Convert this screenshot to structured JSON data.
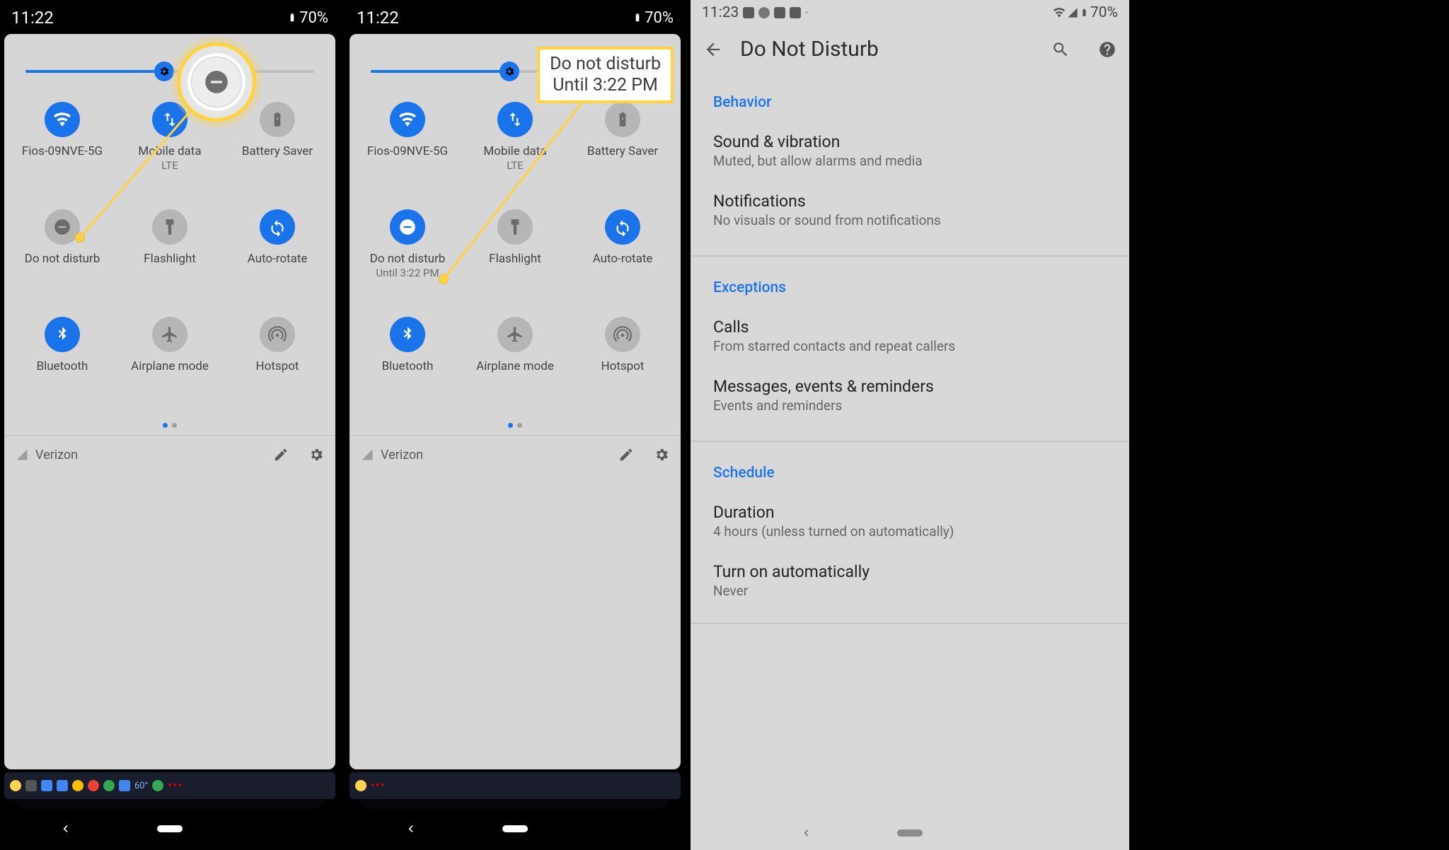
{
  "screens": {
    "a": {
      "time": "11:22",
      "battery": "70%",
      "brightness_pct": 48,
      "carrier": "Verizon",
      "tiles": [
        {
          "name": "wifi",
          "label": "Fios-09NVE-5G",
          "sub": null,
          "on": true,
          "icon": "wifi"
        },
        {
          "name": "mobile-data",
          "label": "Mobile data",
          "sub": "LTE",
          "on": true,
          "icon": "swap"
        },
        {
          "name": "battery-saver",
          "label": "Battery Saver",
          "sub": null,
          "on": false,
          "icon": "battery"
        },
        {
          "name": "dnd",
          "label": "Do not disturb",
          "sub": null,
          "on": false,
          "icon": "dnd"
        },
        {
          "name": "flashlight",
          "label": "Flashlight",
          "sub": null,
          "on": false,
          "icon": "flash"
        },
        {
          "name": "auto-rotate",
          "label": "Auto-rotate",
          "sub": null,
          "on": true,
          "icon": "rotate"
        },
        {
          "name": "bluetooth",
          "label": "Bluetooth",
          "sub": null,
          "on": true,
          "icon": "bt"
        },
        {
          "name": "airplane",
          "label": "Airplane mode",
          "sub": null,
          "on": false,
          "icon": "airplane"
        },
        {
          "name": "hotspot",
          "label": "Hotspot",
          "sub": null,
          "on": false,
          "icon": "hotspot"
        }
      ],
      "strip_temp": "60°"
    },
    "b": {
      "time": "11:22",
      "battery": "70%",
      "brightness_pct": 48,
      "carrier": "Verizon",
      "callout_line1": "Do not disturb",
      "callout_line2": "Until 3:22 PM",
      "tiles": [
        {
          "name": "wifi",
          "label": "Fios-09NVE-5G",
          "sub": null,
          "on": true,
          "icon": "wifi"
        },
        {
          "name": "mobile-data",
          "label": "Mobile data",
          "sub": "LTE",
          "on": true,
          "icon": "swap"
        },
        {
          "name": "battery-saver",
          "label": "Battery Saver",
          "sub": null,
          "on": false,
          "icon": "battery"
        },
        {
          "name": "dnd",
          "label": "Do not disturb",
          "sub": "Until 3:22 PM",
          "on": true,
          "icon": "dnd"
        },
        {
          "name": "flashlight",
          "label": "Flashlight",
          "sub": null,
          "on": false,
          "icon": "flash"
        },
        {
          "name": "auto-rotate",
          "label": "Auto-rotate",
          "sub": null,
          "on": true,
          "icon": "rotate"
        },
        {
          "name": "bluetooth",
          "label": "Bluetooth",
          "sub": null,
          "on": true,
          "icon": "bt"
        },
        {
          "name": "airplane",
          "label": "Airplane mode",
          "sub": null,
          "on": false,
          "icon": "airplane"
        },
        {
          "name": "hotspot",
          "label": "Hotspot",
          "sub": null,
          "on": false,
          "icon": "hotspot"
        }
      ]
    },
    "c": {
      "time": "11:23",
      "battery": "70%",
      "title": "Do Not Disturb",
      "sections": [
        {
          "heading": "Behavior",
          "rows": [
            {
              "title": "Sound & vibration",
              "sub": "Muted, but allow alarms and media"
            },
            {
              "title": "Notifications",
              "sub": "No visuals or sound from notifications"
            }
          ]
        },
        {
          "heading": "Exceptions",
          "rows": [
            {
              "title": "Calls",
              "sub": "From starred contacts and repeat callers"
            },
            {
              "title": "Messages, events & reminders",
              "sub": "Events and reminders"
            }
          ]
        },
        {
          "heading": "Schedule",
          "rows": [
            {
              "title": "Duration",
              "sub": "4 hours (unless turned on automatically)"
            },
            {
              "title": "Turn on automatically",
              "sub": "Never"
            }
          ]
        }
      ]
    }
  }
}
